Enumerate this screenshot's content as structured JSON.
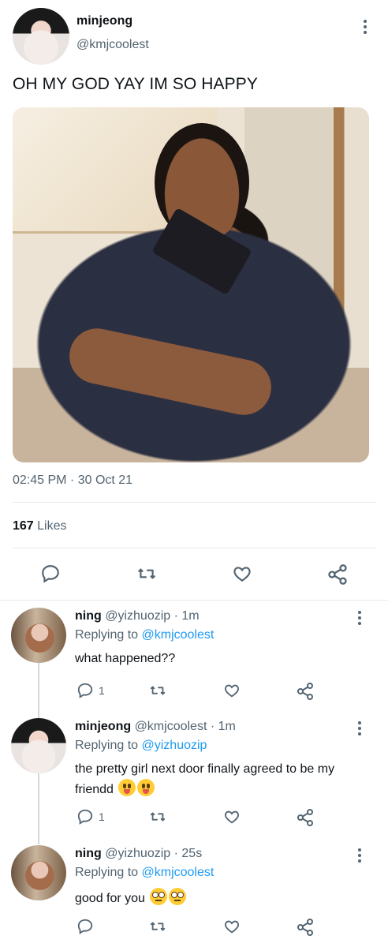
{
  "tweet": {
    "author_name": "minjeong",
    "author_handle": "@kmjcoolest",
    "text": "OH MY GOD YAY IM SO HAPPY",
    "timestamp": "02:45 PM · 30 Oct 21",
    "likes_count": "167",
    "likes_label": "Likes",
    "actions": [
      "reply-icon",
      "retweet-icon",
      "like-icon",
      "share-icon"
    ]
  },
  "replies": [
    {
      "name": "ning",
      "handle": "@yizhuozip",
      "time": "· 1m",
      "replying_label": "Replying to",
      "replying_to": "@kmjcoolest",
      "text": "what happened??",
      "emoji": [],
      "reply_count": "1",
      "avatar": "ning"
    },
    {
      "name": "minjeong",
      "handle": "@kmjcoolest",
      "time": "· 1m",
      "replying_label": "Replying to",
      "replying_to": "@yizhuozip",
      "text": "the pretty girl next door finally agreed to be my friendd",
      "emoji": [
        "face-with-tongue",
        "face-with-tongue"
      ],
      "reply_count": "1",
      "avatar": "minjeong"
    },
    {
      "name": "ning",
      "handle": "@yizhuozip",
      "time": "· 25s",
      "replying_label": "Replying to",
      "replying_to": "@kmjcoolest",
      "text": "good for you",
      "emoji": [
        "face-with-rolling-eyes",
        "face-with-rolling-eyes"
      ],
      "reply_count": "",
      "avatar": "ning"
    }
  ],
  "colors": {
    "link": "#1d9bf0",
    "secondary_text": "#536471",
    "divider": "#e6e9eb"
  }
}
